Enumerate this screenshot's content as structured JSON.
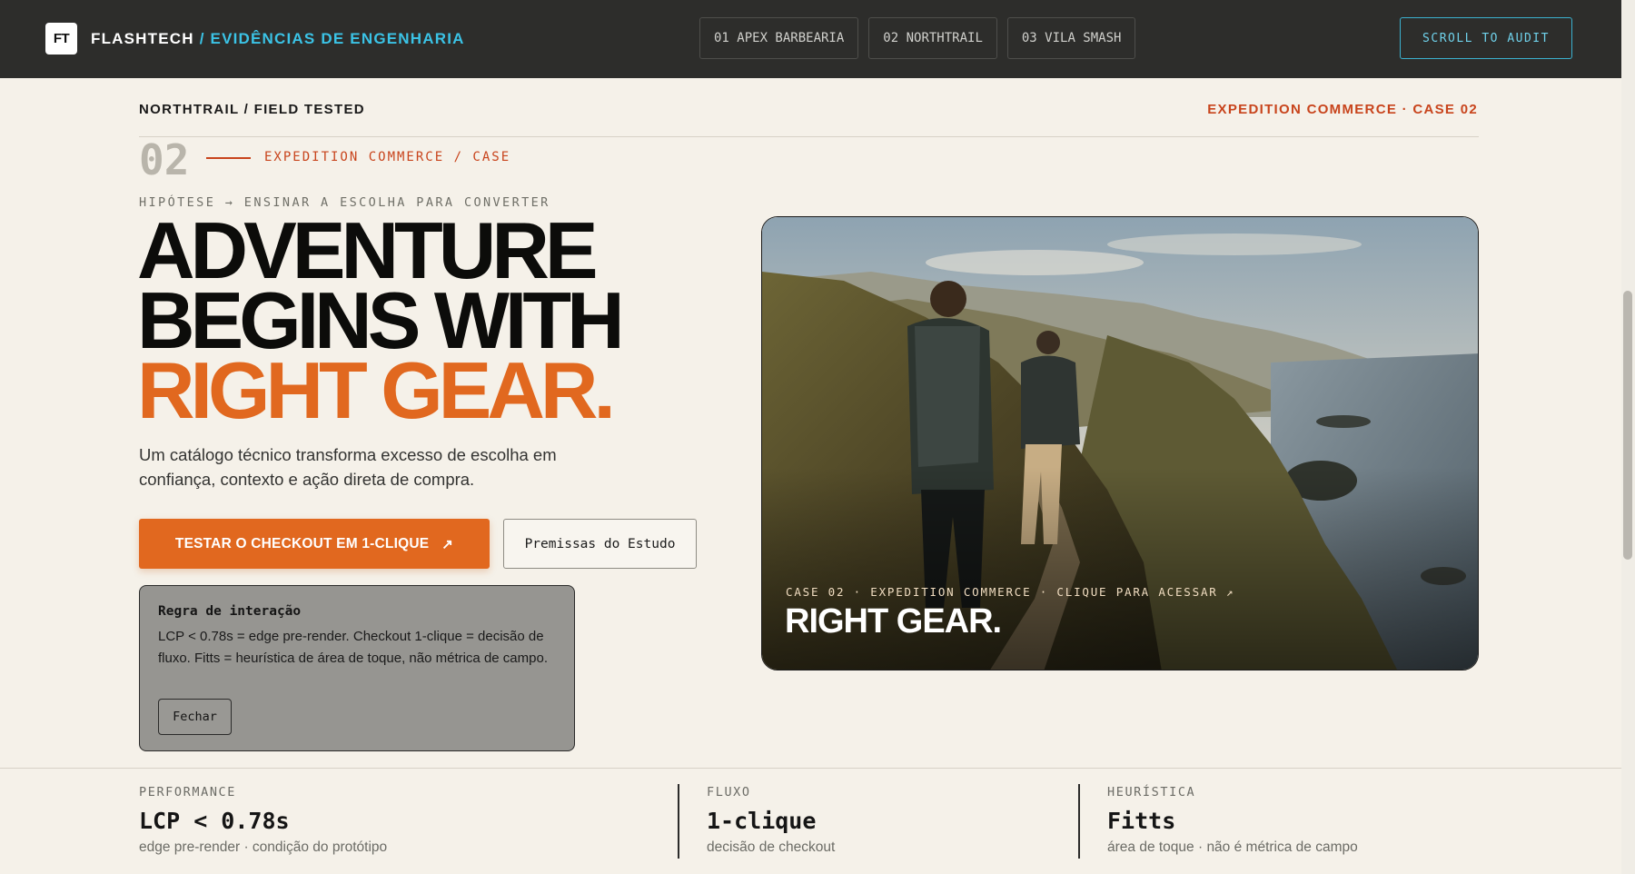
{
  "topbar": {
    "logo_text": "FT",
    "brand_name": "FLASHTECH",
    "brand_subtitle": "/ EVIDÊNCIAS DE ENGENHARIA",
    "tabs": [
      {
        "label": "01 APEX BARBEARIA"
      },
      {
        "label": "02 NORTHTRAIL"
      },
      {
        "label": "03 VILA SMASH"
      }
    ],
    "audit_button": "SCROLL TO AUDIT"
  },
  "section": {
    "breadcrumb_left": "NORTHTRAIL / FIELD TESTED",
    "breadcrumb_right": "EXPEDITION COMMERCE · CASE 02",
    "case_number": "02",
    "case_tag": "EXPEDITION COMMERCE / CASE",
    "hypothesis": "HIPÓTESE → ENSINAR A ESCOLHA PARA CONVERTER"
  },
  "hero_text": {
    "line1": "ADVENTURE",
    "line2": "BEGINS WITH",
    "line3": "RIGHT GEAR.",
    "lede": "Um catálogo técnico transforma excesso de escolha em confiança, contexto e ação direta de compra.",
    "cta_primary": "TESTAR O CHECKOUT EM 1-CLIQUE",
    "cta_primary_icon": "↗",
    "cta_secondary": "Premissas do Estudo"
  },
  "rule_card": {
    "title": "Regra de interação",
    "body": "LCP < 0.78s = edge pre-render. Checkout 1-clique = decisão de fluxo. Fitts = heurística de área de toque, não métrica de campo.",
    "close_label": "Fechar"
  },
  "hero_image": {
    "meta": "CASE 02 · EXPEDITION COMMERCE · CLIQUE PARA ACESSAR ↗",
    "title": "RIGHT GEAR."
  },
  "metrics": [
    {
      "label": "PERFORMANCE",
      "value": "LCP < 0.78s",
      "note": "edge pre-render · condição do protótipo"
    },
    {
      "label": "FLUXO",
      "value": "1-clique",
      "note": "decisão de checkout"
    },
    {
      "label": "HEURÍSTICA",
      "value": "Fitts",
      "note": "área de toque · não é métrica de campo"
    }
  ],
  "colors": {
    "accent_orange": "#e1681f",
    "accent_red": "#c8441c",
    "accent_cyan": "#3bc3e6",
    "topbar_bg": "#2d2d2b",
    "page_bg": "#f5f1e9"
  }
}
